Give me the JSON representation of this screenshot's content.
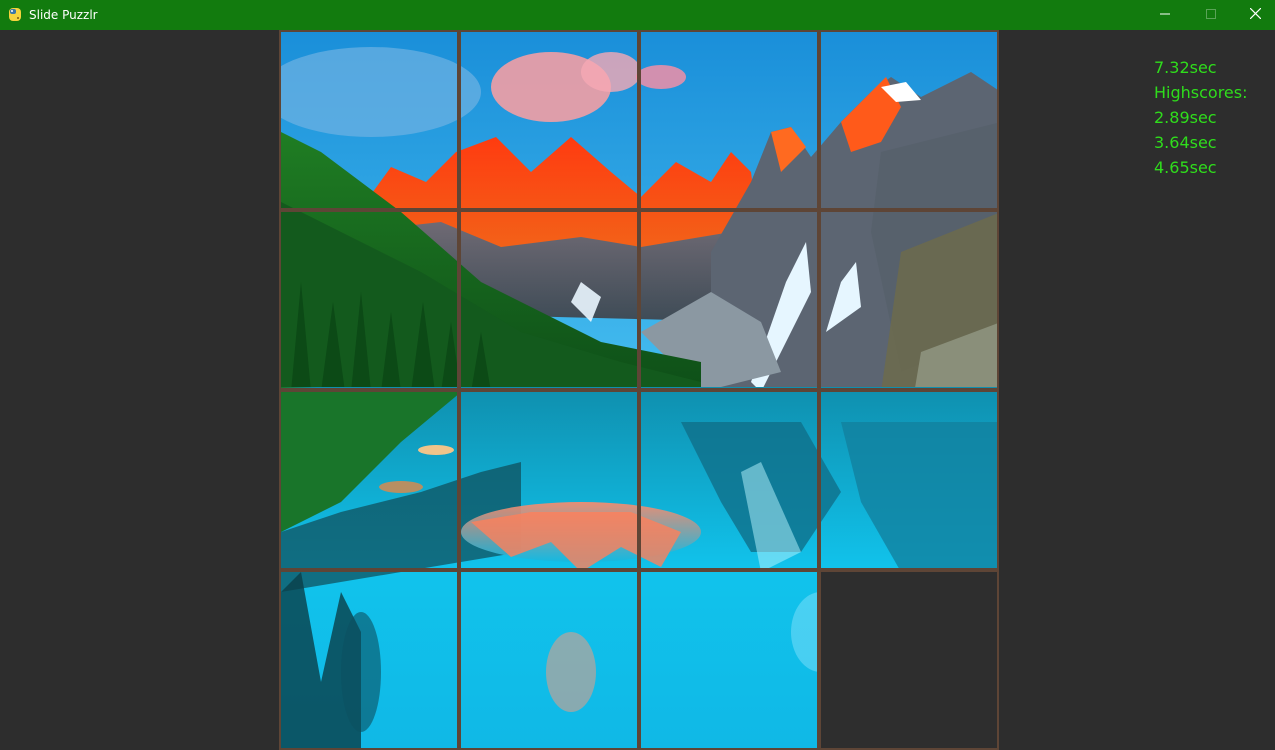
{
  "window": {
    "title": "Slide Puzzlr",
    "titlebar_color": "#127b0e",
    "icons": {
      "app": "python-icon",
      "minimize": "minimize-icon",
      "maximize": "maximize-icon",
      "close": "close-icon"
    }
  },
  "board": {
    "grid": "4x4",
    "image": "mountain lake with forest and snow-capped peaks",
    "tiles": [
      {
        "id": 1,
        "empty": false
      },
      {
        "id": 2,
        "empty": false
      },
      {
        "id": 3,
        "empty": false
      },
      {
        "id": 4,
        "empty": false
      },
      {
        "id": 5,
        "empty": false
      },
      {
        "id": 6,
        "empty": false
      },
      {
        "id": 7,
        "empty": false
      },
      {
        "id": 8,
        "empty": false
      },
      {
        "id": 9,
        "empty": false
      },
      {
        "id": 10,
        "empty": false
      },
      {
        "id": 11,
        "empty": false
      },
      {
        "id": 12,
        "empty": false
      },
      {
        "id": 13,
        "empty": false
      },
      {
        "id": 14,
        "empty": false
      },
      {
        "id": 15,
        "empty": false
      },
      {
        "id": 16,
        "empty": true
      }
    ],
    "border_color": "#5e4536"
  },
  "scores": {
    "current": "7.32sec",
    "highscores_label": "Highscores:",
    "highscores": [
      "2.89sec",
      "3.64sec",
      "4.65sec"
    ],
    "text_color": "#2fdd1c"
  }
}
